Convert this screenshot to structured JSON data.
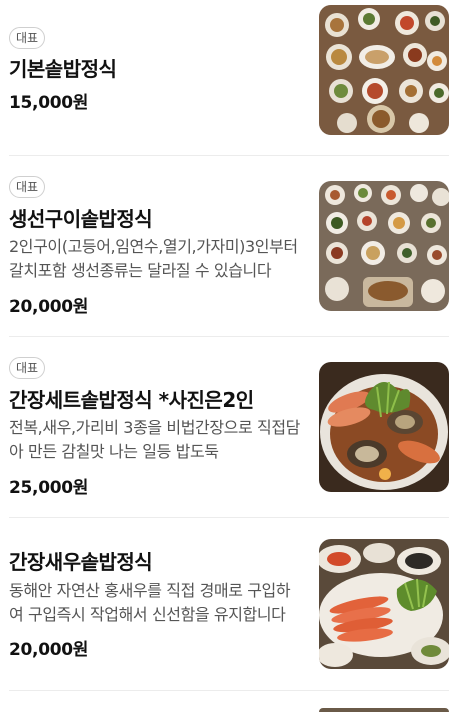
{
  "menu": {
    "items": [
      {
        "badge": "대표",
        "name": "기본솥밥정식",
        "description": "",
        "price": "15,000원"
      },
      {
        "badge": "대표",
        "name": "생선구이솥밥정식",
        "description": "2인구이(고등어,임연수,열기,가자미)3인부터 갈치포함 생선종류는 달라질 수 있습니다",
        "price": "20,000원"
      },
      {
        "badge": "대표",
        "name": "간장세트솥밥정식 *사진은2인",
        "description": "전복,새우,가리비 3종을 비법간장으로 직접담아 만든 감칠맛 나는 일등 밥도둑",
        "price": "25,000원"
      },
      {
        "badge": "",
        "name": "간장새우솥밥정식",
        "description": "동해안 자연산 홍새우를 직접 경매로 구입하여 구입즉시 작업해서 신선함을 유지합니다",
        "price": "20,000원"
      }
    ]
  },
  "colors": {
    "accent_border": "#cfcfcf",
    "divider": "#ececec"
  }
}
